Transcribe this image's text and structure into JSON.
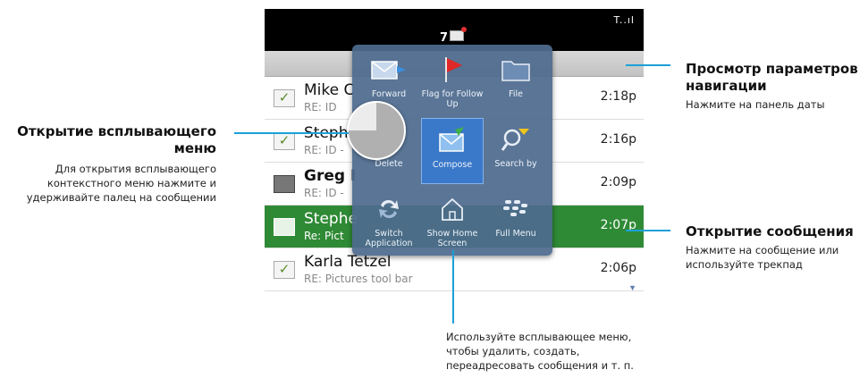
{
  "colors": {
    "callout_line": "#1ca0d8",
    "popup_bg": "#4e6a8e",
    "selected_row": "#2f8a35",
    "active_cell": "#3a78c9"
  },
  "status": {
    "signal": "T..ıl",
    "notification_count": "7"
  },
  "messages": [
    {
      "name": "Mike C",
      "subject": "RE: ID",
      "time": "2:18p",
      "icon": "opened-check-icon"
    },
    {
      "name": "Steph",
      "subject": "RE: ID -",
      "time": "2:16p",
      "icon": "opened-check-icon"
    },
    {
      "name": "Greg I",
      "subject": "RE: ID -",
      "time": "2:09p",
      "icon": "unread-envelope-icon"
    },
    {
      "name": "Stephe",
      "subject": "Re: Pict",
      "time": "2:07p",
      "icon": "open-envelope-icon"
    },
    {
      "name": "Karla Tetzel",
      "subject": "RE: Pictures tool bar",
      "time": "2:06p",
      "icon": "opened-check-icon"
    }
  ],
  "popup": {
    "items": [
      {
        "label": "Forward",
        "icon": "forward-icon"
      },
      {
        "label": "Flag for Follow Up",
        "icon": "flag-icon"
      },
      {
        "label": "File",
        "icon": "folder-icon"
      },
      {
        "label": "Delete",
        "icon": "delete-icon"
      },
      {
        "label": "Compose",
        "icon": "compose-icon"
      },
      {
        "label": "Search by",
        "icon": "search-icon"
      },
      {
        "label": "Switch Application",
        "icon": "switch-app-icon"
      },
      {
        "label": "Show Home Screen",
        "icon": "home-icon"
      },
      {
        "label": "Full Menu",
        "icon": "blackberry-menu-icon"
      }
    ]
  },
  "callouts": {
    "nav": {
      "title": "Просмотр параметров навигации",
      "text": "Нажмите на панель даты"
    },
    "popup_open": {
      "title": "Открытие всплывающего меню",
      "text": "Для открытия всплывающего контекстного меню нажмите и удерживайте палец на сообщении"
    },
    "open_msg": {
      "title": "Открытие сообщения",
      "text": "Нажмите на сообщение или используйте трекпад"
    },
    "bottom": {
      "text": "Используйте всплывающее меню, чтобы удалить, создать, переадресовать сообщения и т. п."
    }
  }
}
